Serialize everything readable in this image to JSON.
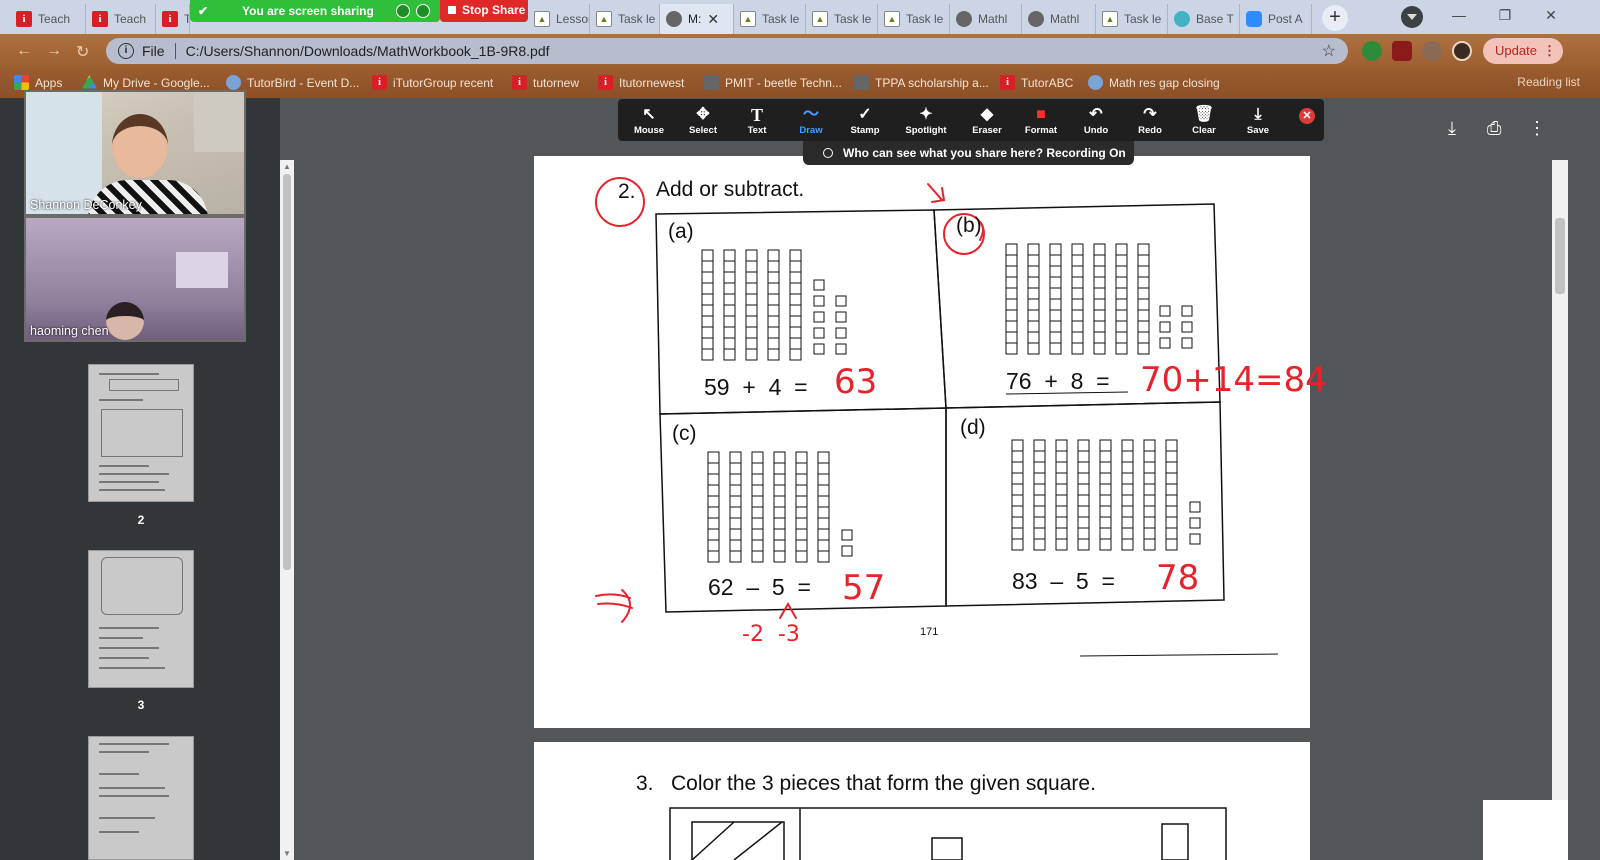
{
  "browser": {
    "tabs": [
      {
        "label": "Teach",
        "icon": "itutor-icon"
      },
      {
        "label": "Teach",
        "icon": "itutor-icon"
      },
      {
        "label": "T",
        "icon": "itutor-icon"
      },
      {
        "label": "Lessor",
        "icon": "doc-icon"
      },
      {
        "label": "Task le",
        "icon": "doc-icon"
      },
      {
        "label": "M:",
        "icon": "globe-icon",
        "active": true
      },
      {
        "label": "Task le",
        "icon": "doc-icon"
      },
      {
        "label": "Task le",
        "icon": "doc-icon"
      },
      {
        "label": "Task le",
        "icon": "doc-icon"
      },
      {
        "label": "Mathl",
        "icon": "globe-icon"
      },
      {
        "label": "Mathl",
        "icon": "globe-icon"
      },
      {
        "label": "Task le",
        "icon": "doc-icon"
      },
      {
        "label": "Base T",
        "icon": "teal-icon"
      },
      {
        "label": "Post A",
        "icon": "zoom-icon"
      }
    ],
    "new_tab": "+",
    "address": {
      "scheme_label": "File",
      "url": "C:/Users/Shannon/Downloads/MathWorkbook_1B-9R8.pdf"
    },
    "update_label": "Update",
    "bookmarks": [
      {
        "label": "Apps"
      },
      {
        "label": "My Drive - Google..."
      },
      {
        "label": "TutorBird - Event D..."
      },
      {
        "label": "iTutorGroup recent"
      },
      {
        "label": "tutornew"
      },
      {
        "label": "Itutornewest"
      },
      {
        "label": "PMIT - beetle Techn..."
      },
      {
        "label": "TPPA scholarship a..."
      },
      {
        "label": "TutorABC"
      },
      {
        "label": "Math res gap closing"
      }
    ],
    "reading_list": "Reading list"
  },
  "zoom": {
    "sharing_banner": "You are screen sharing",
    "stop_share": "Stop Share",
    "tools": [
      {
        "label": "Mouse",
        "icon": "↖"
      },
      {
        "label": "Select",
        "icon": "✥"
      },
      {
        "label": "Text",
        "icon": "T"
      },
      {
        "label": "Draw",
        "icon": "〜",
        "active": true
      },
      {
        "label": "Stamp",
        "icon": "✓"
      },
      {
        "label": "Spotlight",
        "icon": "✦"
      },
      {
        "label": "Eraser",
        "icon": "◆"
      },
      {
        "label": "Format",
        "icon": "■"
      },
      {
        "label": "Undo",
        "icon": "↶"
      },
      {
        "label": "Redo",
        "icon": "↷"
      },
      {
        "label": "Clear",
        "icon": "🗑"
      },
      {
        "label": "Save",
        "icon": "⤓"
      }
    ],
    "share_notice": "Who can see what you share here? Recording On",
    "participants": [
      "Shannon DeConkey",
      "haoming   chen"
    ]
  },
  "pdf": {
    "thumbnails": [
      "2",
      "3"
    ],
    "problem_number": "2.",
    "problem_title": "Add or subtract.",
    "parts": [
      {
        "label": "(a)",
        "equation": "59  +  4  =",
        "answer": "63"
      },
      {
        "label": "(b)",
        "equation": "76  +  8  =",
        "answer": "70+14=84"
      },
      {
        "label": "(c)",
        "equation": "62  –  5  =",
        "answer": "57"
      },
      {
        "label": "(d)",
        "equation": "83  –  5  =",
        "answer": "78"
      }
    ],
    "decompose_note": "-2  -3",
    "page_number": "171",
    "next_problem_number": "3.",
    "next_problem_title": "Color the 3 pieces that form the given square."
  },
  "colors": {
    "ink": "#e8222a",
    "zoom_green": "#2fbf3a",
    "stop_red": "#e02828",
    "draw_active": "#4a9eff"
  }
}
